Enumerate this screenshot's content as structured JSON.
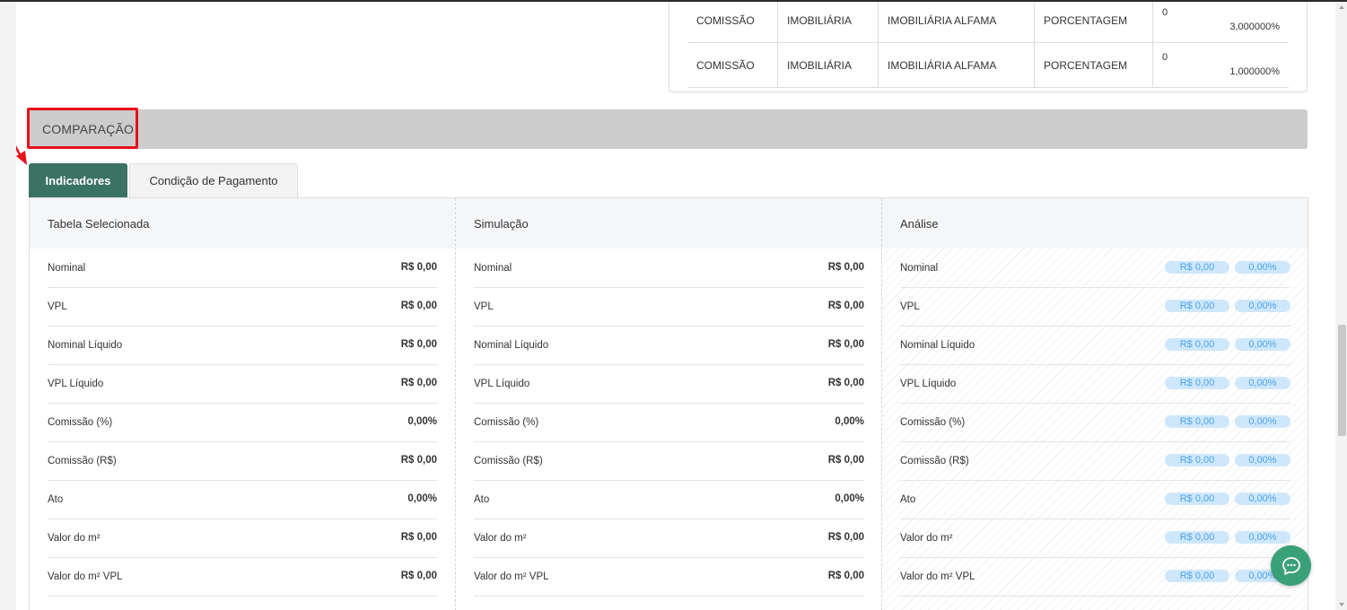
{
  "commission_rows": [
    {
      "type": "COMISSÃO",
      "category": "IMOBILIÁRIA",
      "name": "IMOBILIÁRIA ALFAMA",
      "mode": "PORCENTAGEM",
      "qty": "0",
      "value": "3,000000%"
    },
    {
      "type": "COMISSÃO",
      "category": "IMOBILIÁRIA",
      "name": "IMOBILIÁRIA ALFAMA",
      "mode": "PORCENTAGEM",
      "qty": "0",
      "value": "1,000000%"
    }
  ],
  "section": {
    "title": "COMPARAÇÃO"
  },
  "tabs": [
    {
      "label": "Indicadores",
      "active": true
    },
    {
      "label": "Condição de Pagamento",
      "active": false
    }
  ],
  "columns": {
    "selected": "Tabela Selecionada",
    "simulation": "Simulação",
    "analysis": "Análise"
  },
  "rows": [
    {
      "label": "Nominal",
      "selected": "R$ 0,00",
      "simulation": "R$ 0,00",
      "analysis_value": "R$ 0,00",
      "analysis_pct": "0,00%"
    },
    {
      "label": "VPL",
      "selected": "R$ 0,00",
      "simulation": "R$ 0,00",
      "analysis_value": "R$ 0,00",
      "analysis_pct": "0,00%"
    },
    {
      "label": "Nominal Líquido",
      "selected": "R$ 0,00",
      "simulation": "R$ 0,00",
      "analysis_value": "R$ 0,00",
      "analysis_pct": "0,00%"
    },
    {
      "label": "VPL Líquido",
      "selected": "R$ 0,00",
      "simulation": "R$ 0,00",
      "analysis_value": "R$ 0,00",
      "analysis_pct": "0,00%"
    },
    {
      "label": "Comissão (%)",
      "selected": "0,00%",
      "simulation": "0,00%",
      "analysis_value": "R$ 0,00",
      "analysis_pct": "0,00%"
    },
    {
      "label": "Comissão (R$)",
      "selected": "R$ 0,00",
      "simulation": "R$ 0,00",
      "analysis_value": "R$ 0,00",
      "analysis_pct": "0,00%"
    },
    {
      "label": "Ato",
      "selected": "0,00%",
      "simulation": "0,00%",
      "analysis_value": "R$ 0,00",
      "analysis_pct": "0,00%"
    },
    {
      "label": "Valor do m²",
      "selected": "R$ 0,00",
      "simulation": "R$ 0,00",
      "analysis_value": "R$ 0,00",
      "analysis_pct": "0,00%"
    },
    {
      "label": "Valor do m² VPL",
      "selected": "R$ 0,00",
      "simulation": "R$ 0,00",
      "analysis_value": "R$ 0,00",
      "analysis_pct": "0,00%"
    }
  ],
  "colors": {
    "tab_active": "#3a7264",
    "badge_bg": "#cfe7fb",
    "badge_text": "#4aa3ea",
    "highlight": "#e8101a",
    "chat_fab": "#3aa077"
  },
  "icons": {
    "chat": "chat-bubble-icon",
    "annotation": "red-arrow-icon"
  }
}
